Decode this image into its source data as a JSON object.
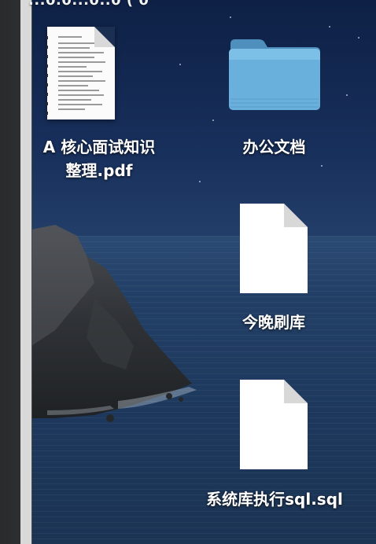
{
  "window": {
    "title_fragment": "...0.0...0..0 ( 0'"
  },
  "desktop": {
    "icons": [
      {
        "kind": "pdf-document",
        "icon": "pdf-document-icon",
        "label_line1": "A 核心面试知识",
        "label_line2": "整理.pdf"
      },
      {
        "kind": "folder",
        "icon": "folder-icon",
        "label_line1": "办公文档"
      },
      {
        "kind": "file",
        "icon": "file-icon",
        "label_line1": "今晚刷库"
      },
      {
        "kind": "file",
        "icon": "file-icon",
        "label_line1": "系统库执行sql.sql"
      }
    ]
  },
  "colors": {
    "folder_blue": "#6ab0dc",
    "folder_tab": "#4f8fbd",
    "label_text": "#ffffff"
  }
}
